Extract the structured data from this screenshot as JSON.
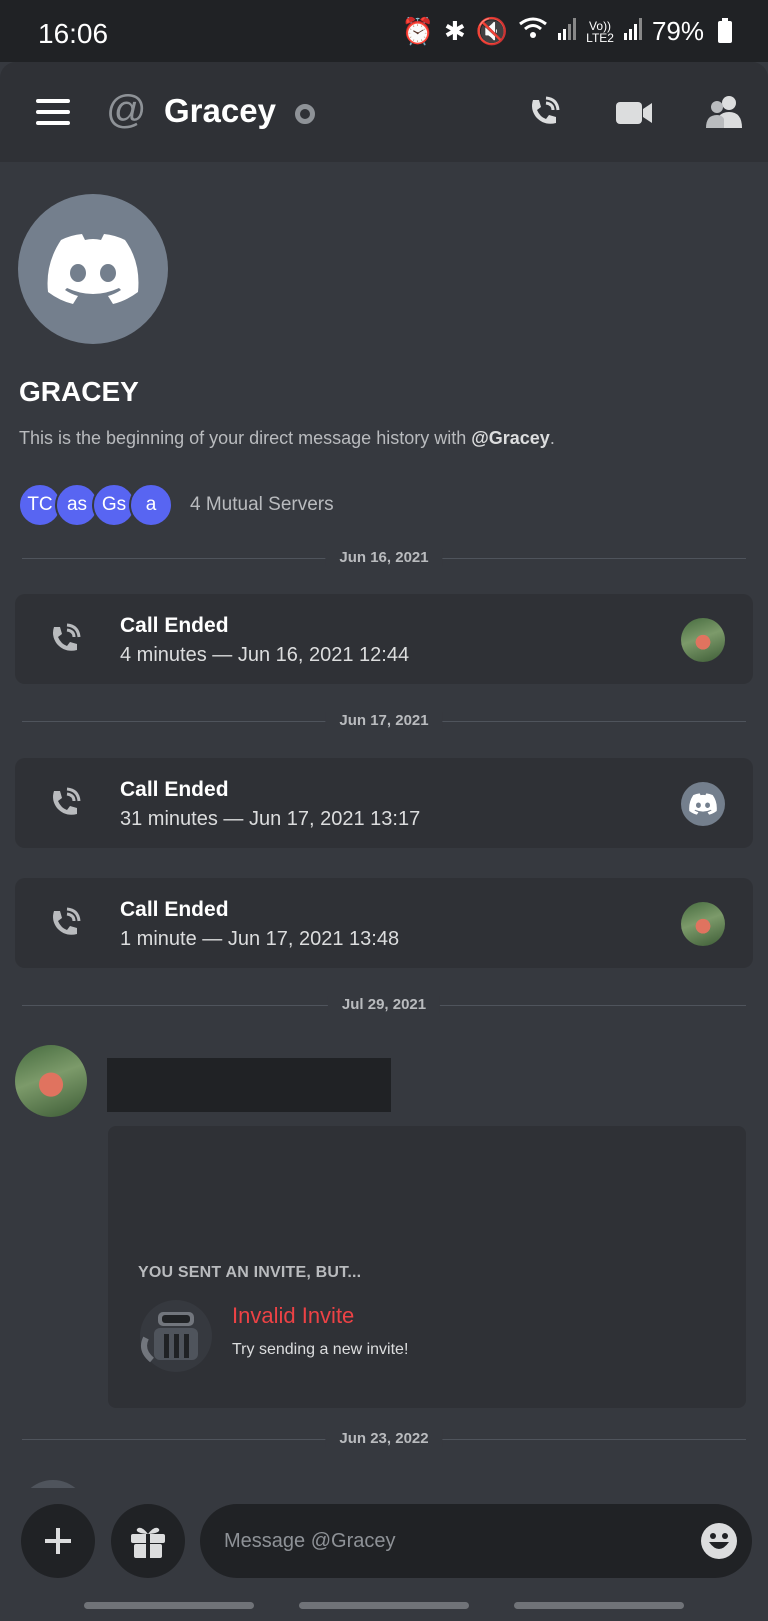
{
  "status_bar": {
    "time": "16:06",
    "network_top": "Vo))",
    "network_bottom": "LTE2",
    "battery": "79%"
  },
  "header": {
    "title": "Gracey",
    "icons": [
      "menu-icon",
      "at-icon",
      "status-idle-icon",
      "phone-call-icon",
      "video-icon",
      "members-icon"
    ]
  },
  "intro": {
    "name": "GRACEY",
    "description_prefix": "This is the beginning of your direct message history with ",
    "description_handle": "@Gracey",
    "description_suffix": ".",
    "mutual_servers": [
      "TC",
      "as",
      "Gs",
      "a"
    ],
    "mutual_label": "4 Mutual Servers"
  },
  "timeline": {
    "dates": [
      "Jun 16, 2021",
      "Jun 17, 2021",
      "Jul 29, 2021",
      "Jun 23, 2022"
    ],
    "calls": [
      {
        "title": "Call Ended",
        "detail": "4 minutes — Jun 16, 2021 12:44"
      },
      {
        "title": "Call Ended",
        "detail": "31 minutes — Jun 17, 2021 13:17"
      },
      {
        "title": "Call Ended",
        "detail": "1 minute — Jun 17, 2021 13:48"
      }
    ]
  },
  "invite": {
    "header": "YOU SENT AN INVITE, BUT...",
    "title": "Invalid Invite",
    "subtitle": "Try sending a new invite!"
  },
  "composer": {
    "placeholder": "Message @Gracey"
  },
  "colors": {
    "background": "#36393f",
    "panel": "#2f3136",
    "blurple": "#5865f2",
    "danger": "#ed4245"
  }
}
